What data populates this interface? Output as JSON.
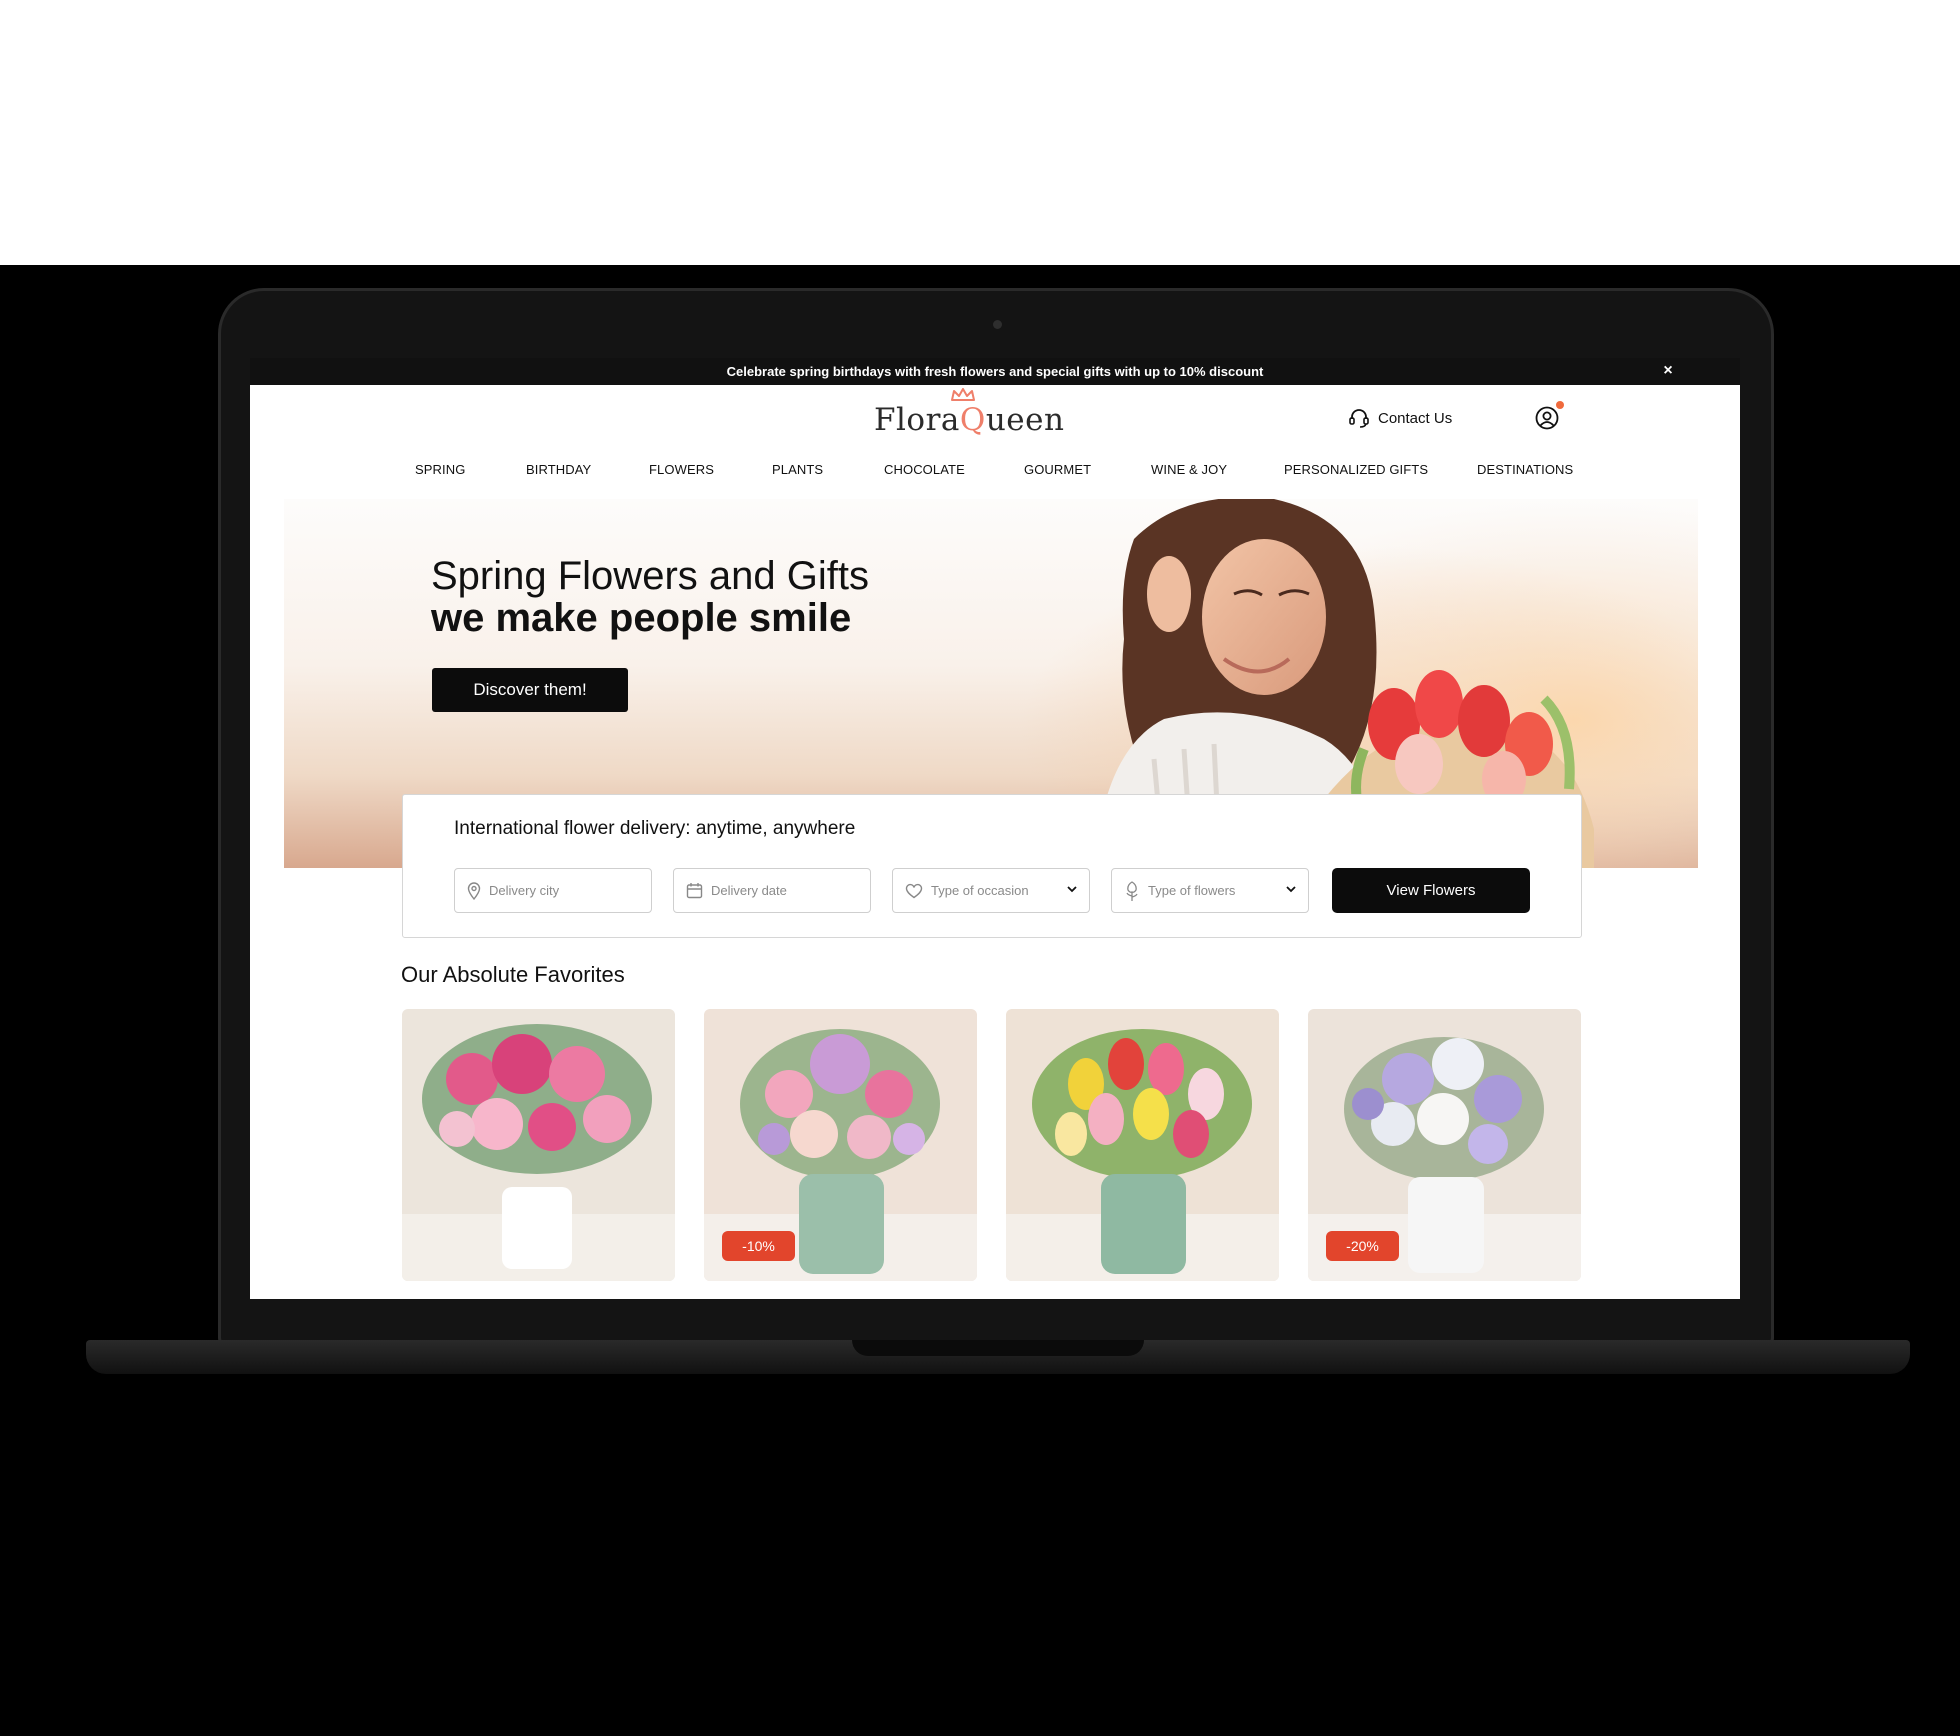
{
  "promo": {
    "text": "Celebrate spring birthdays with fresh flowers and special gifts with up to 10% discount",
    "close_icon": "close-icon"
  },
  "header": {
    "logo": {
      "part1": "Flora",
      "part2": "Q",
      "part3": "ueen"
    },
    "contact_label": "Contact Us",
    "contact_icon": "headset-icon",
    "account_icon": "user-circle-icon"
  },
  "nav": {
    "items": [
      "SPRING",
      "BIRTHDAY",
      "FLOWERS",
      "PLANTS",
      "CHOCOLATE",
      "GOURMET",
      "WINE & JOY",
      "PERSONALIZED GIFTS",
      "DESTINATIONS"
    ]
  },
  "hero": {
    "title": "Spring Flowers and Gifts",
    "subtitle": "we make people smile",
    "button_label": "Discover them!"
  },
  "search": {
    "title": "International flower delivery: anytime, anywhere",
    "city_placeholder": "Delivery city",
    "date_placeholder": "Delivery date",
    "occasion_placeholder": "Type of occasion",
    "flowers_placeholder": "Type of flowers",
    "button_label": "View Flowers"
  },
  "favorites": {
    "title": "Our Absolute Favorites",
    "products": [
      {
        "badge": ""
      },
      {
        "badge": "-10%"
      },
      {
        "badge": ""
      },
      {
        "badge": "-20%"
      }
    ]
  },
  "colors": {
    "brand_accent": "#ef7f6a",
    "badge": "#e2452c",
    "button": "#0c0c0c",
    "notification_dot": "#f06a3c"
  }
}
